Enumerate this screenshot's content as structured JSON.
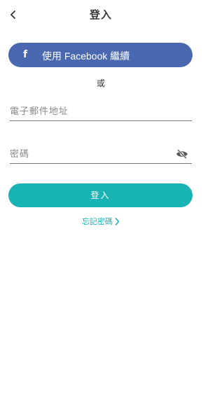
{
  "header": {
    "title": "登入",
    "back_icon": "chevron-left-icon"
  },
  "facebook": {
    "icon": "facebook-icon",
    "icon_glyph": "f",
    "label": "使用 Facebook 繼續"
  },
  "divider": {
    "or_text": "或"
  },
  "form": {
    "email_placeholder": "電子郵件地址",
    "email_value": "",
    "password_placeholder": "密碼",
    "password_value": "",
    "password_toggle_icon": "eye-off-icon"
  },
  "actions": {
    "login_label": "登入",
    "forgot_label": "忘記密碼",
    "forgot_icon": "chevron-right-icon"
  },
  "colors": {
    "facebook_blue": "#4a68b0",
    "accent_teal": "#17b3b5",
    "text_dark": "#333333",
    "underline_gray": "#7a7a7a",
    "background": "#ffffff"
  }
}
